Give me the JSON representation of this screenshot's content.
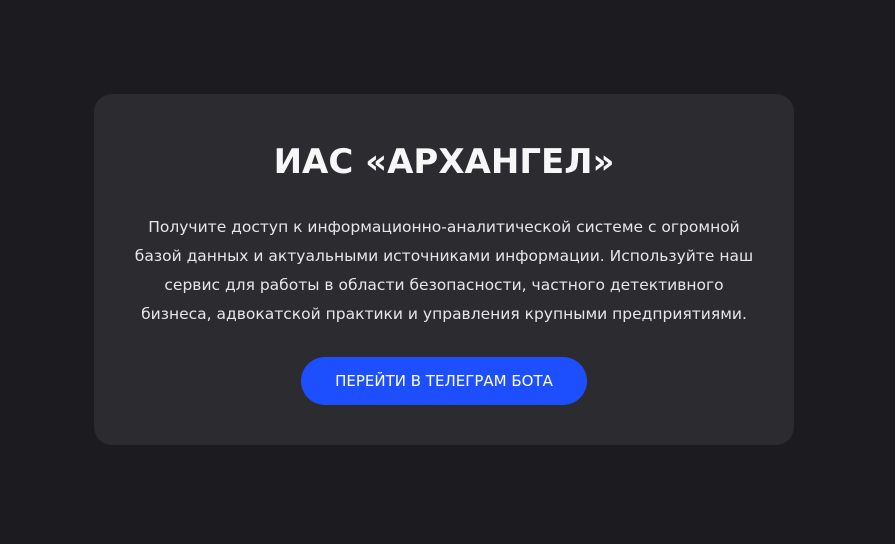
{
  "colors": {
    "page_background": "#1c1b1f",
    "card_background": "#2c2b2f",
    "title_text": "#f7f7f8",
    "body_text": "#e6e6e8",
    "button_background": "#1d4fff",
    "button_text": "#ffffff"
  },
  "card": {
    "title": "ИАС «АРХАНГЕЛ»",
    "description": "Получите доступ к информационно-аналитической системе с огромной базой данных и актуальными источниками информации. Используйте наш сервис для работы в области безопасности, частного детективного бизнеса, адвокатской практики и управления крупными предприятиями.",
    "cta_label": "ПЕРЕЙТИ В ТЕЛЕГРАМ БОТА"
  }
}
